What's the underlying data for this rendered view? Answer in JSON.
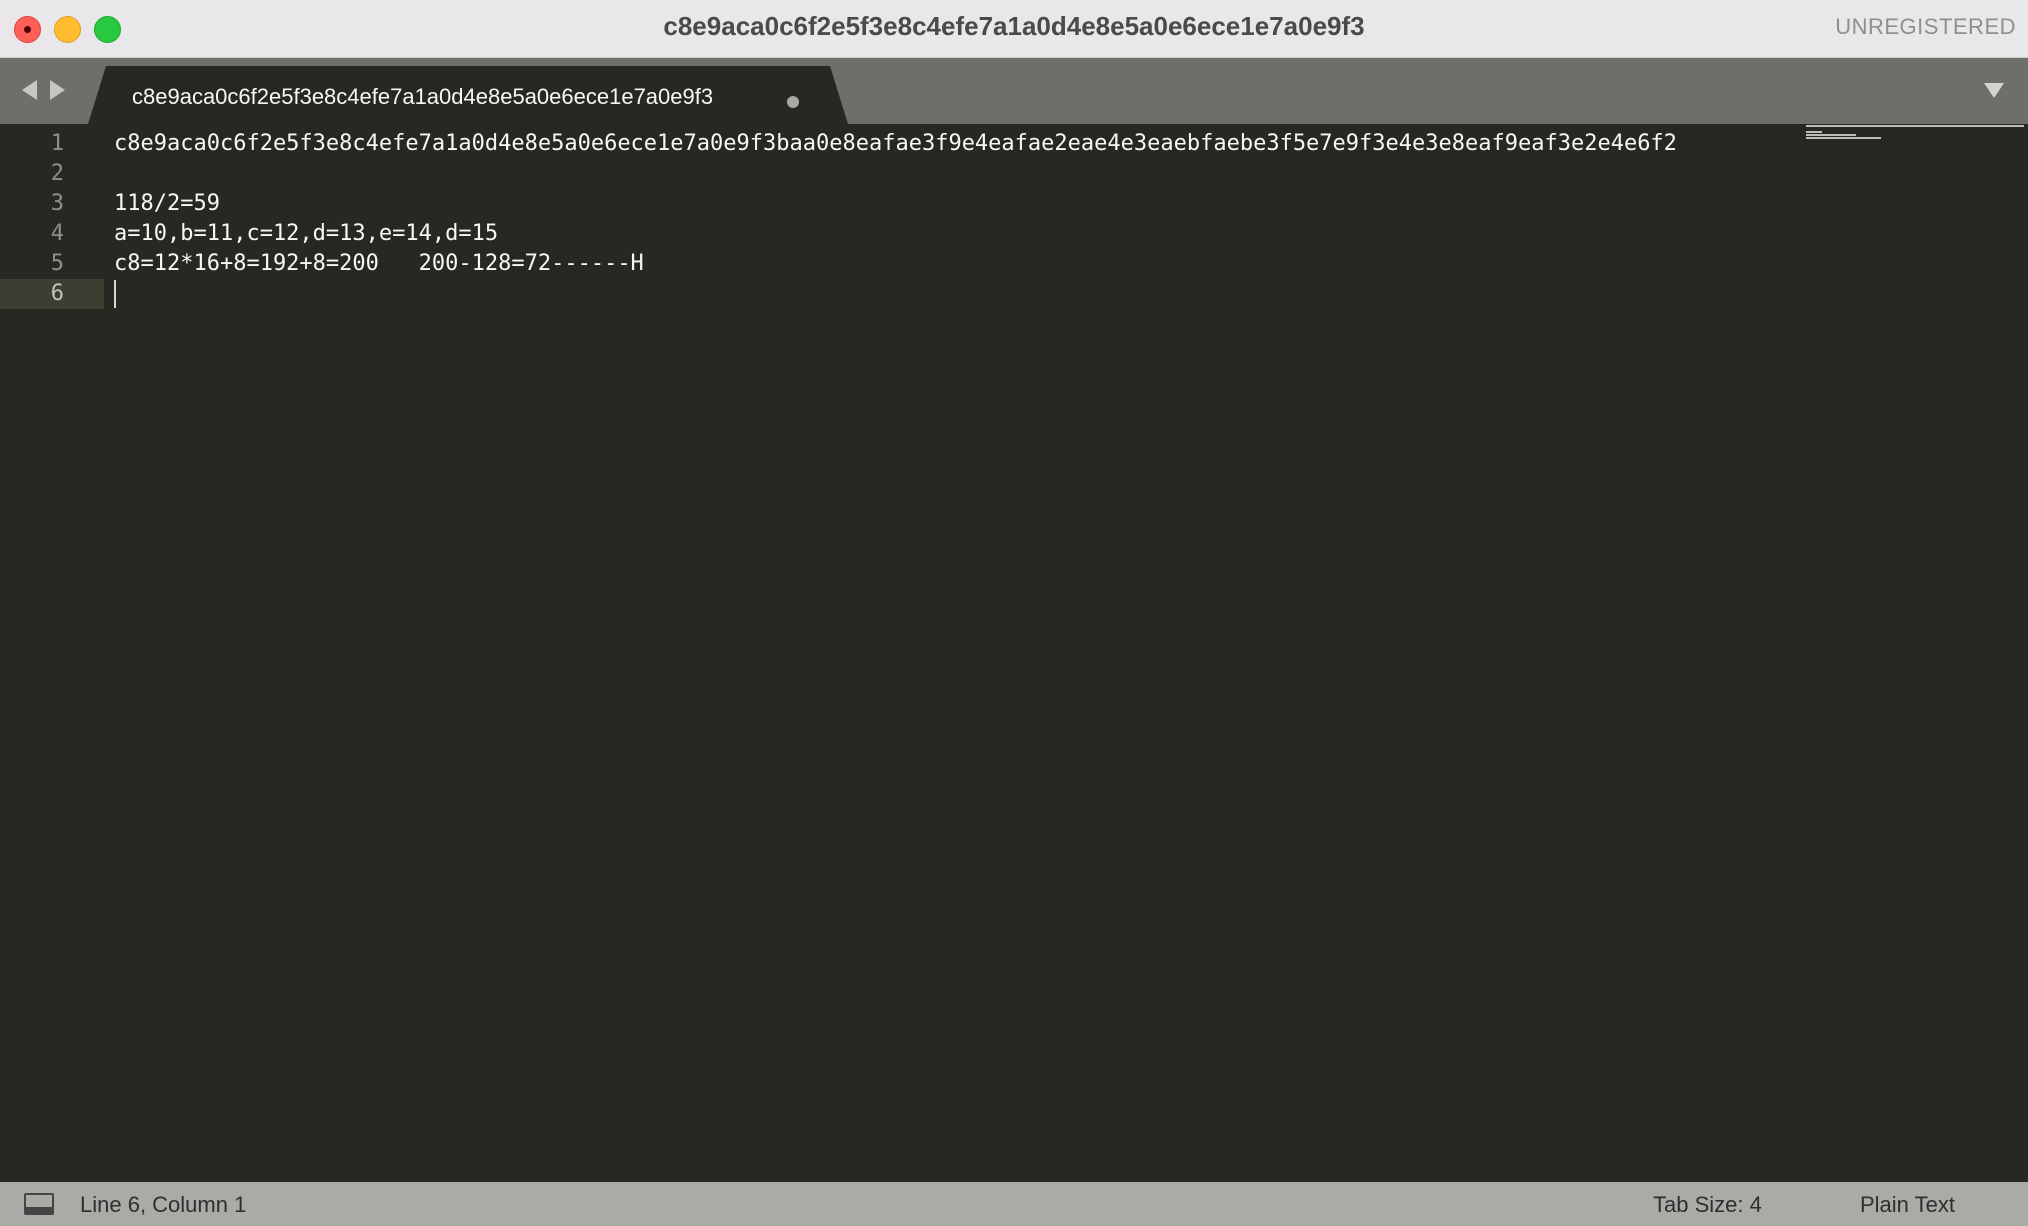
{
  "window": {
    "title": "c8e9aca0c6f2e5f3e8c4efe7a1a0d4e8e5a0e6ece1e7a0e9f3",
    "license_notice": "UNREGISTERED"
  },
  "tabs": [
    {
      "label": "c8e9aca0c6f2e5f3e8c4efe7a1a0d4e8e5a0e6ece1e7a0e9f3",
      "dirty": true,
      "active": true
    }
  ],
  "editor": {
    "lines": [
      {
        "number": "1",
        "text": "c8e9aca0c6f2e5f3e8c4efe7a1a0d4e8e5a0e6ece1e7a0e9f3baa0e8eafae3f9e4eafae2eae4e3eaebfaebe3f5e7e9f3e4e3e8eaf9eaf3e2e4e6f2"
      },
      {
        "number": "2",
        "text": ""
      },
      {
        "number": "3",
        "text": "118/2=59"
      },
      {
        "number": "4",
        "text": "a=10,b=11,c=12,d=13,e=14,d=15"
      },
      {
        "number": "5",
        "text": "c8=12*16+8=192+8=200   200-128=72------H"
      },
      {
        "number": "6",
        "text": ""
      }
    ],
    "active_line": 6
  },
  "status": {
    "position": "Line 6, Column 1",
    "tab_size": "Tab Size: 4",
    "syntax": "Plain Text"
  },
  "colors": {
    "editor_bg": "#272822",
    "text": "#f8f8f2",
    "line_number": "#8f908a",
    "active_line": "#3e3d32",
    "tabbar_bg": "#6e6f69",
    "statusbar_bg": "#a9aba7",
    "titlebar_bg": "#e9e7e9"
  },
  "icons": {
    "close": "close-button-icon",
    "minimize": "minimize-button-icon",
    "zoom": "zoom-button-icon",
    "back": "arrow-left-icon",
    "forward": "arrow-right-icon",
    "dirty": "unsaved-dot-icon",
    "dropdown": "chevron-down-icon",
    "panel": "panel-toggle-icon"
  }
}
